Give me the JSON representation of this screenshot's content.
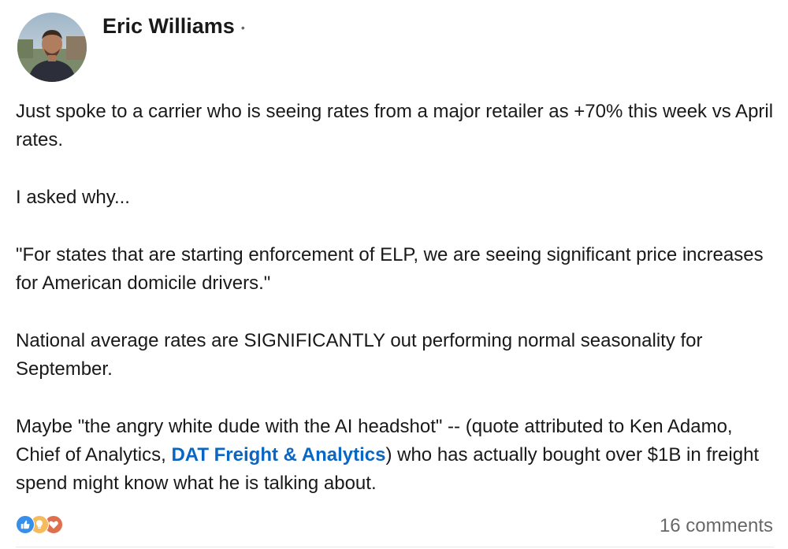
{
  "author": {
    "name": "Eric Williams",
    "separator": "•"
  },
  "post": {
    "paragraphs": [
      "Just spoke to a carrier who is seeing rates from a major retailer as +70% this week vs April rates.",
      "I asked why...",
      "\"For states that are starting enforcement of ELP, we are seeing significant price increases for American domicile drivers.\"",
      "National average rates are SIGNIFICANTLY out performing normal seasonality for September."
    ],
    "last_paragraph": {
      "before_mention": "Maybe \"the angry white dude with the AI headshot\" -- (quote attributed to Ken Adamo, Chief of Analytics, ",
      "mention": "DAT Freight & Analytics",
      "after_mention": ") who has actually bought over $1B in freight spend might know what he is talking about."
    }
  },
  "reactions": {
    "icons": [
      "like-icon",
      "insightful-icon",
      "love-icon"
    ],
    "colors": {
      "like": "#378fe9",
      "insightful": "#f5bb5c",
      "love": "#df704d"
    }
  },
  "footer": {
    "comments_label": "16 comments"
  },
  "colors": {
    "mention": "#0a66c2",
    "muted_text": "#666666"
  }
}
